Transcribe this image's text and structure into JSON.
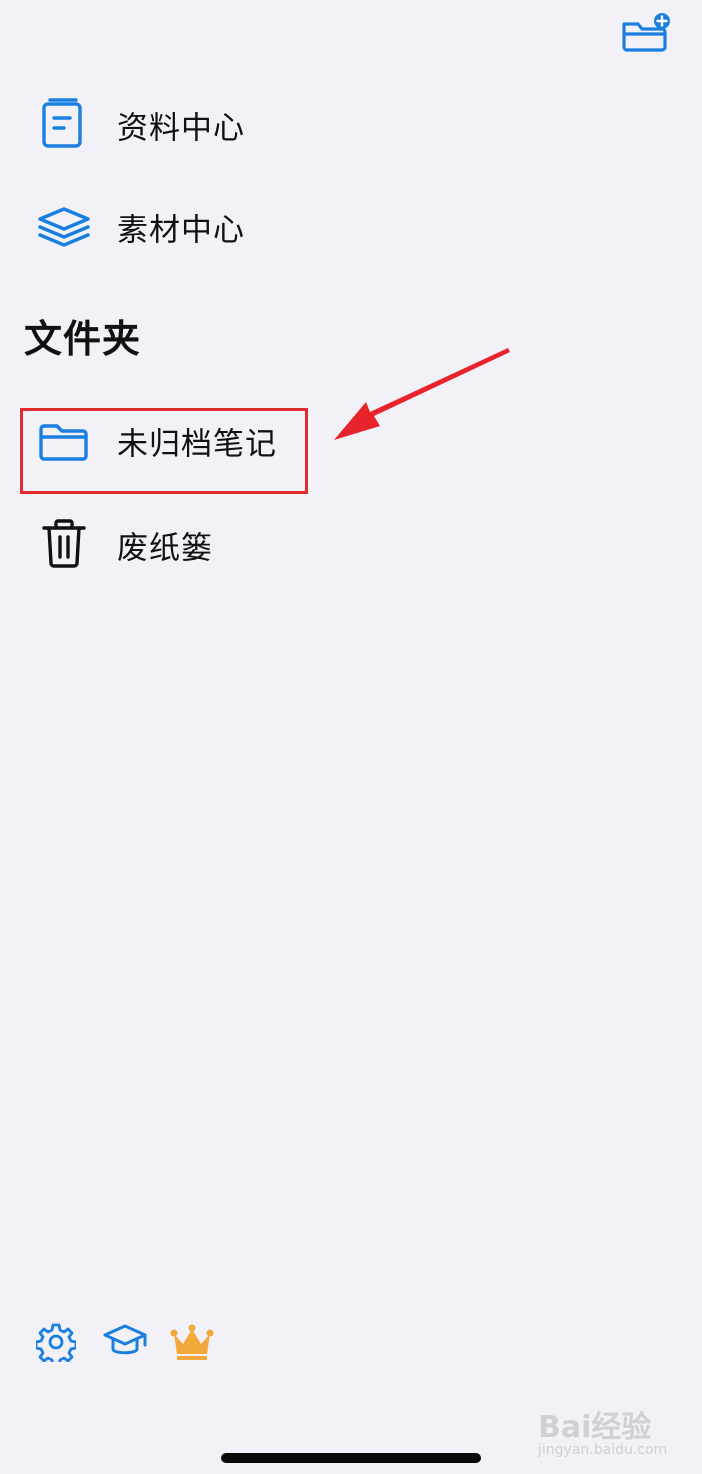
{
  "menu": {
    "items": [
      {
        "label": "资料中心",
        "icon": "document-book-icon"
      },
      {
        "label": "素材中心",
        "icon": "layers-stack-icon"
      }
    ]
  },
  "folders": {
    "heading": "文件夹",
    "items": [
      {
        "label": "未归档笔记",
        "icon": "folder-icon",
        "highlighted": true
      },
      {
        "label": "废纸篓",
        "icon": "trash-icon"
      }
    ]
  },
  "toolbar": {
    "new_folder_icon": "folder-add-icon",
    "bottom_icons": [
      "gear-icon",
      "graduation-cap-icon",
      "crown-icon"
    ]
  },
  "annotation": {
    "highlight_color": "#e02a2e"
  },
  "colors": {
    "accent": "#1a7fe0",
    "crown": "#f3a93a",
    "background": "#f2f1f7",
    "text": "#111111"
  },
  "watermark": {
    "brand": "Bai经验",
    "url": "jingyan.baidu.com"
  }
}
